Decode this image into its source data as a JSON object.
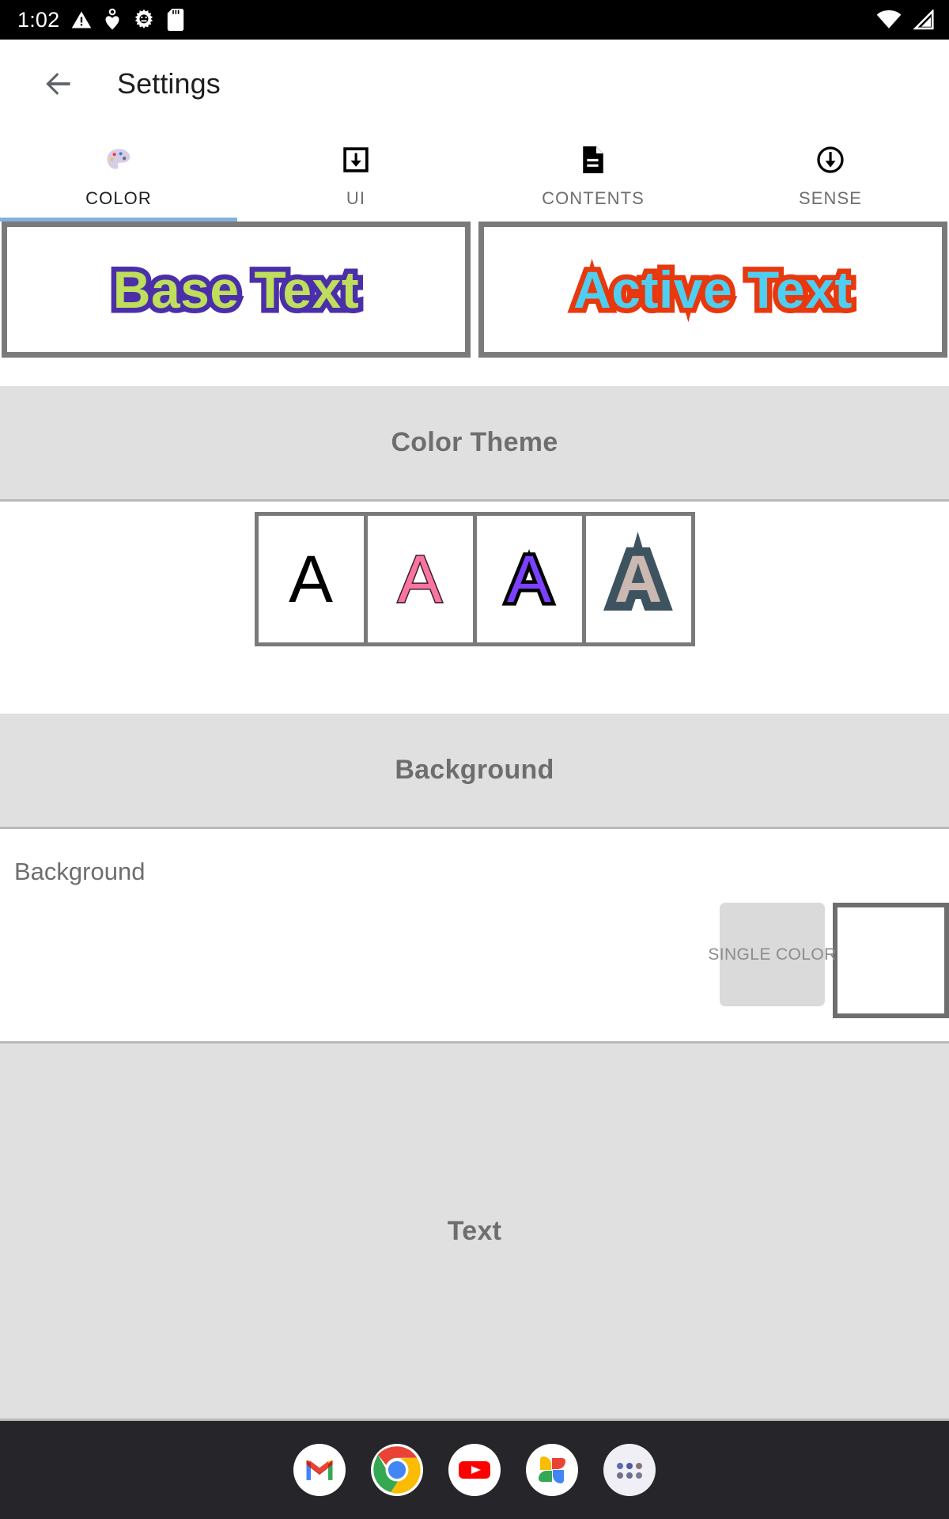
{
  "status_bar": {
    "clock": "1:02",
    "left_icons": [
      "warning-triangle-icon",
      "bluetooth-heart-icon",
      "gear-icon",
      "sd-card-icon"
    ],
    "right_icons": [
      "wifi-icon",
      "cell-signal-icon"
    ],
    "background": "#000000"
  },
  "app_bar": {
    "back_icon": "back-arrow-icon",
    "title": "Settings"
  },
  "tabs": {
    "active_index": 0,
    "indicator_color": "#82b1e0",
    "items": [
      {
        "label": "COLOR",
        "icon": "palette-icon"
      },
      {
        "label": "UI",
        "icon": "download-box-icon"
      },
      {
        "label": "CONTENTS",
        "icon": "document-icon"
      },
      {
        "label": "SENSE",
        "icon": "circled-down-arrow-icon"
      }
    ]
  },
  "preview": {
    "base": {
      "text": "Base Text",
      "fill_color": "#bede5c",
      "outline_color": "#4b2fa8"
    },
    "active": {
      "text": "Active Text",
      "fill_color": "#4ecef0",
      "outline_color": "#e8380d"
    }
  },
  "color_theme": {
    "header": "Color Theme",
    "swatches": [
      {
        "glyph": "A",
        "fill_color": "#000000",
        "outline_color": "#000000"
      },
      {
        "glyph": "A",
        "fill_color": "#f9749e",
        "outline_color": "#3a2030"
      },
      {
        "glyph": "A",
        "fill_color": "#7b41ff",
        "outline_color": "#000000"
      },
      {
        "glyph": "A",
        "fill_color": "#cbb8b0",
        "outline_color": "#3d5360"
      }
    ]
  },
  "background_section": {
    "header": "Background",
    "row_label": "Background",
    "single_color_button": "SINGLE COLOR",
    "swatch_color": "#ffffff"
  },
  "text_section": {
    "header": "Text"
  },
  "dock": {
    "items": [
      {
        "name": "gmail-icon"
      },
      {
        "name": "chrome-icon"
      },
      {
        "name": "youtube-icon"
      },
      {
        "name": "google-photos-icon"
      },
      {
        "name": "app-drawer-icon"
      }
    ]
  }
}
